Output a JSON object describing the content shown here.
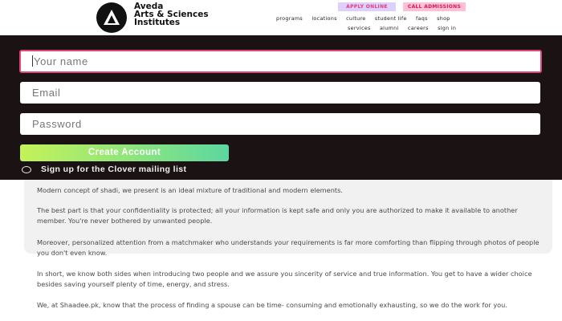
{
  "brand": {
    "name_line1": "Aveda",
    "name_line2": "Arts & Sciences",
    "name_line3": "Institutes",
    "logo_icon": "aveda-triangle-logo"
  },
  "header": {
    "apply_label": "APPLY ONLINE",
    "call_label": "CALL ADMISSIONS",
    "nav_row1": [
      "programs",
      "locations",
      "culture",
      "student life",
      "faqs",
      "shop"
    ],
    "nav_row2": [
      "services",
      "alumni",
      "careers",
      "sign in"
    ]
  },
  "form": {
    "name_placeholder": "Your name",
    "email_placeholder": "Email",
    "password_placeholder": "Password",
    "create_label": "Create Account",
    "mailing_label": "Sign up for the Clover mailing list"
  },
  "article": {
    "p1": "Modern concept of shadi, we present is an ideal mixture of traditional and modern elements.",
    "p2": "The best part is that your confidentiality is protected; all your information is kept safe and only you are authorized to make it available to another member. You're never bothered by unwanted people.",
    "p3": "Moreover, personalized attention from a matchmaker who understands your requirements is far more comforting than flipping through photos of people you don't even know.",
    "p4": "In short, we know both sides when introducing two people and we assure you sincerity of service and true information. You get to have a wider choice besides saving yourself plenty of time, energy, and stress.",
    "p5": "We, at Shaadee.pk, know that the process of finding a spouse can be time- consuming and emotionally exhausting, so we do the work for you."
  },
  "colors": {
    "panel_bg": "#1a1213",
    "active_border": "#e0457a",
    "apply_bg": "#ddd0ff",
    "call_bg": "#ffbfd6"
  }
}
